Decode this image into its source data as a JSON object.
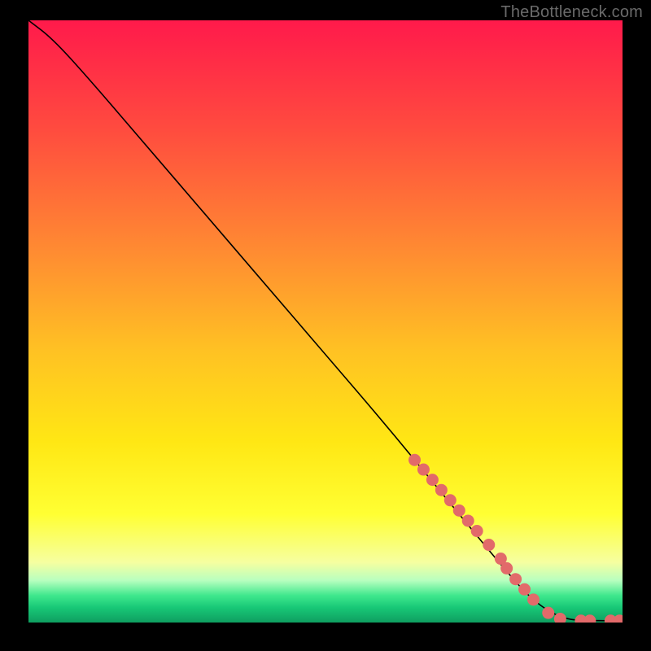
{
  "attribution": "TheBottleneck.com",
  "chart_data": {
    "type": "line",
    "title": "",
    "xlabel": "",
    "ylabel": "",
    "xlim": [
      0,
      100
    ],
    "ylim": [
      0,
      100
    ],
    "line": {
      "x": [
        0,
        4,
        10,
        20,
        30,
        40,
        50,
        60,
        70,
        80,
        85,
        90,
        95,
        100
      ],
      "y": [
        100,
        97,
        90.5,
        79,
        67.5,
        56,
        44.5,
        33,
        21,
        9,
        3.5,
        0.5,
        0.3,
        0.3
      ]
    },
    "markers": {
      "x": [
        65,
        66.5,
        68,
        69.5,
        71,
        72.5,
        74,
        75.5,
        77.5,
        79.5,
        80.5,
        82,
        83.5,
        85,
        87.5,
        89.5,
        93,
        94.5,
        98,
        99.5
      ],
      "y": [
        27.0,
        25.4,
        23.7,
        22.0,
        20.3,
        18.6,
        16.9,
        15.2,
        12.9,
        10.6,
        9.0,
        7.2,
        5.5,
        3.8,
        1.6,
        0.6,
        0.3,
        0.3,
        0.3,
        0.3
      ]
    },
    "gradient_stops": [
      {
        "offset": 0.0,
        "color": "#ff1a4b"
      },
      {
        "offset": 0.18,
        "color": "#ff4b3f"
      },
      {
        "offset": 0.38,
        "color": "#ff8a32"
      },
      {
        "offset": 0.55,
        "color": "#ffc223"
      },
      {
        "offset": 0.7,
        "color": "#ffe714"
      },
      {
        "offset": 0.82,
        "color": "#ffff33"
      },
      {
        "offset": 0.9,
        "color": "#f6ffa0"
      },
      {
        "offset": 0.93,
        "color": "#b8ffbf"
      },
      {
        "offset": 0.955,
        "color": "#3fe88d"
      },
      {
        "offset": 0.975,
        "color": "#18c877"
      },
      {
        "offset": 1.0,
        "color": "#0f9e60"
      }
    ],
    "marker_color": "#e26a6a",
    "line_color": "#000000"
  }
}
